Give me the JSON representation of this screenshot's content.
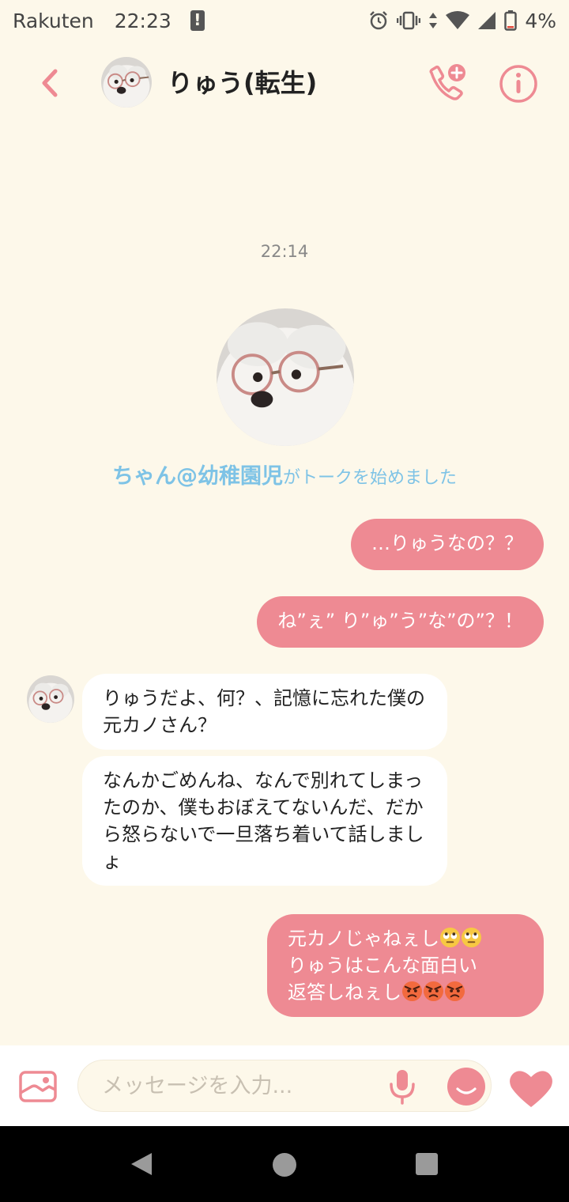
{
  "status_bar": {
    "carrier": "Rakuten",
    "time": "22:23",
    "battery": "4%",
    "icons": [
      "alert-icon",
      "alarm-icon",
      "vibrate-icon",
      "data-arrows-icon",
      "wifi-icon",
      "signal-icon",
      "battery-icon"
    ]
  },
  "header": {
    "title": "りゅう(転生)",
    "icons": [
      "back-arrow-icon",
      "add-call-icon",
      "info-icon"
    ],
    "accent_color": "#ee8a93"
  },
  "chat": {
    "timestamp": "22:14",
    "started_user": "ちゃん@幼稚園児",
    "started_text": "がトークを始めました",
    "messages": [
      {
        "side": "out",
        "text": "…りゅうなの？？"
      },
      {
        "side": "out",
        "text": "ね”ぇ” り”ゅ”う”な”の”？！"
      },
      {
        "side": "in",
        "text": "りゅうだよ、何？、記憶に忘れた僕の元カノさん？"
      },
      {
        "side": "in",
        "text": "なんかごめんね、なんで別れてしまったのか、僕もおぼえてないんだ、だから怒らないで一旦落ち着いて話しましょ"
      },
      {
        "side": "out",
        "line1": "元カノじゃねぇし",
        "line2": "りゅうはこんな面白い",
        "line3": "返答しねぇし",
        "emojis_line1": [
          "eye-roll-emoji",
          "eye-roll-emoji"
        ],
        "emojis_line3": [
          "angry-emoji",
          "angry-emoji",
          "angry-emoji"
        ]
      }
    ]
  },
  "input_bar": {
    "placeholder": "メッセージを入力..."
  },
  "colors": {
    "background": "#fdf8ea",
    "bubble_out": "#ee8a93",
    "bubble_in": "#ffffff",
    "started_text": "#7ec3e6"
  }
}
